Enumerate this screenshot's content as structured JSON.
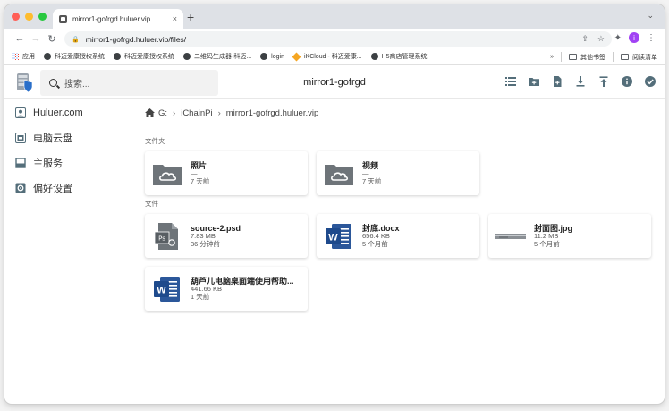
{
  "browser": {
    "tab_title": "mirror1-gofrgd.huluer.vip",
    "tab_close": "×",
    "new_tab": "+",
    "tab_dropdown": "⌄",
    "url": "mirror1-gofrgd.huluer.vip/files/",
    "profile_initial": "i",
    "bookmarks": [
      {
        "label": "应用",
        "icon": "apps-grid-icon"
      },
      {
        "label": "科迈爱康授权系统",
        "icon": "globe-icon"
      },
      {
        "label": "科迈爱康授权系统",
        "icon": "globe-icon"
      },
      {
        "label": "二维码生成器-科迈...",
        "icon": "globe-icon"
      },
      {
        "label": "login",
        "icon": "globe-icon"
      },
      {
        "label": "iKCloud - 科迈爱康...",
        "icon": "diamond-icon"
      },
      {
        "label": "H5商店管理系统",
        "icon": "globe-icon"
      }
    ],
    "bookmarks_more": "»",
    "other_bookmarks": "其他书签",
    "reading_list": "阅读清单"
  },
  "app": {
    "title": "mirror1-gofrgd",
    "search_placeholder": "搜索...",
    "actions": [
      "list-view-icon",
      "new-folder-icon",
      "new-file-icon",
      "download-icon",
      "upload-icon",
      "info-icon",
      "select-icon"
    ]
  },
  "sidebar": {
    "items": [
      {
        "label": "Huluer.com",
        "icon": "user-icon"
      },
      {
        "label": "电脑云盘",
        "icon": "folder-icon"
      },
      {
        "label": "主服务",
        "icon": "server-icon"
      },
      {
        "label": "偏好设置",
        "icon": "settings-icon"
      }
    ]
  },
  "main": {
    "breadcrumb": [
      "G:",
      "iChainPi",
      "mirror1-gofrgd.huluer.vip"
    ],
    "folders_heading": "文件夹",
    "folders": [
      {
        "name": "照片",
        "size": "—",
        "modified": "7 天前"
      },
      {
        "name": "视频",
        "size": "—",
        "modified": "7 天前"
      }
    ],
    "files_heading": "文件",
    "files": [
      {
        "name": "source-2.psd",
        "size": "7.83 MB",
        "modified": "36 分钟前",
        "icon": "psd-file-icon"
      },
      {
        "name": "封底.docx",
        "size": "656.4 KB",
        "modified": "5 个月前",
        "icon": "word-file-icon"
      },
      {
        "name": "封面图.jpg",
        "size": "11.2 MB",
        "modified": "5 个月前",
        "icon": "image-thumbnail-icon"
      },
      {
        "name": "葫芦儿电脑桌面端使用帮助...",
        "size": "441.66 KB",
        "modified": "1 天前",
        "icon": "word-file-icon"
      }
    ]
  },
  "colors": {
    "word_blue": "#2b579a",
    "profile": "#a142f4"
  }
}
